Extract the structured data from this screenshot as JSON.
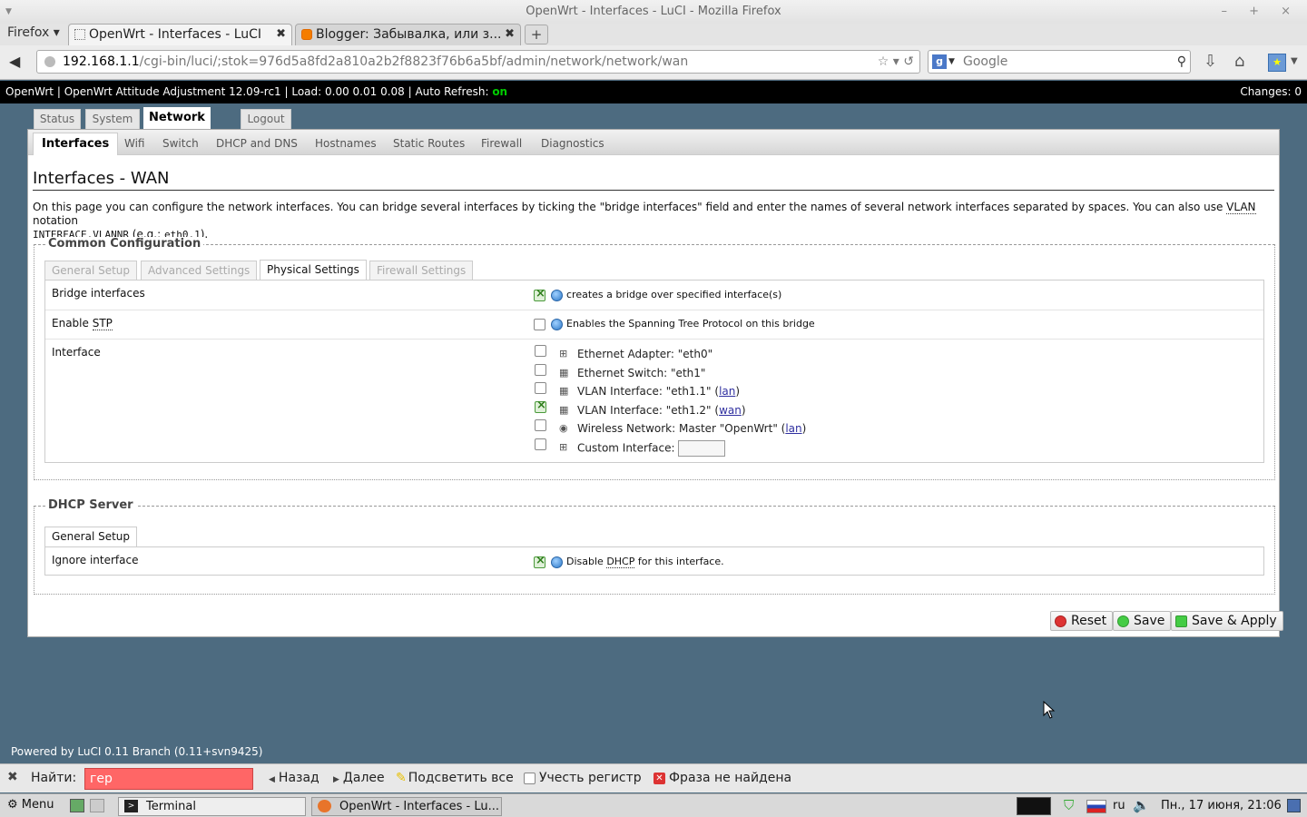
{
  "window": {
    "title": "OpenWrt - Interfaces - LuCI - Mozilla Firefox",
    "controls": "– + ×"
  },
  "firefox_menu": "Firefox ▾",
  "browser_tabs": [
    {
      "label": "OpenWrt - Interfaces - LuCI",
      "active": true
    },
    {
      "label": "Blogger: Забывалка, или з...",
      "active": false
    }
  ],
  "new_tab": "+",
  "urlbar": {
    "host": "192.168.1.1",
    "path": "/cgi-bin/luci/;stok=976d5a8fd2a810a2b2f8823f76b6a5bf/admin/network/network/wan",
    "tools": "☆ ▾ ↺"
  },
  "searchbar": {
    "engine": "g",
    "placeholder": "Google"
  },
  "luci_header": {
    "info": "OpenWrt | OpenWrt Attitude Adjustment 12.09-rc1 | Load: 0.00 0.01 0.08 | Auto Refresh: ",
    "auto_refresh": "on",
    "changes": "Changes: 0"
  },
  "main_tabs": [
    "Status",
    "System",
    "Network",
    "Logout"
  ],
  "sub_tabs": [
    "Interfaces",
    "Wifi",
    "Switch",
    "DHCP and DNS",
    "Hostnames",
    "Static Routes",
    "Firewall",
    "Diagnostics"
  ],
  "page": {
    "title": "Interfaces - WAN",
    "desc_1": "On this page you can configure the network interfaces. You can bridge several interfaces by ticking the \"bridge interfaces\" field and enter the names of several network interfaces separated by spaces. You can also use ",
    "desc_vlan": "VLAN",
    "desc_2": " notation",
    "desc_code1": "INTERFACE.VLANNR",
    "desc_3": " (",
    "desc_eg": "e.g.",
    "desc_4": ": ",
    "desc_code2": "eth0.1",
    "desc_5": ")."
  },
  "common": {
    "legend": "Common Configuration",
    "tabs": [
      "General Setup",
      "Advanced Settings",
      "Physical Settings",
      "Firewall Settings"
    ],
    "bridge": {
      "label": "Bridge interfaces",
      "checked": true,
      "help": "creates a bridge over specified interface(s)"
    },
    "stp": {
      "label_1": "Enable ",
      "label_abbr": "STP",
      "checked": false,
      "help": "Enables the Spanning Tree Protocol on this bridge"
    },
    "interface": {
      "label": "Interface",
      "options": [
        {
          "text": "Ethernet Adapter: \"eth0\"",
          "net": "",
          "checked": false,
          "icon": "ethernet-icon"
        },
        {
          "text": "Ethernet Switch: \"eth1\"",
          "net": "",
          "checked": false,
          "icon": "switch-icon"
        },
        {
          "text": "VLAN Interface: \"eth1.1\" (",
          "net": "lan",
          "checked": false,
          "icon": "switch-icon"
        },
        {
          "text": "VLAN Interface: \"eth1.2\" (",
          "net": "wan",
          "checked": true,
          "icon": "switch-icon"
        },
        {
          "text": "Wireless Network: Master \"OpenWrt\" (",
          "net": "lan",
          "checked": false,
          "icon": "wireless-icon"
        },
        {
          "text": "Custom Interface:",
          "net": "",
          "checked": false,
          "icon": "ethernet-icon"
        }
      ],
      "custom_value": ""
    }
  },
  "dhcp": {
    "legend": "DHCP Server",
    "tab": "General Setup",
    "ignore": {
      "label": "Ignore interface",
      "checked": true,
      "help_1": "Disable ",
      "help_abbr": "DHCP",
      "help_2": " for this interface."
    }
  },
  "buttons": {
    "reset": "Reset",
    "save": "Save",
    "apply": "Save & Apply"
  },
  "footer": "Powered by LuCI 0.11 Branch (0.11+svn9425)",
  "findbar": {
    "label": "Найти:",
    "value": "гер",
    "prev": "Назад",
    "next": "Далее",
    "highlight": "Подсветить все",
    "match_case": "Учесть регистр",
    "status": "Фраза не найдена"
  },
  "taskbar": {
    "menu": "Menu",
    "tasks": [
      "Terminal",
      "OpenWrt - Interfaces - Lu..."
    ],
    "lang": "ru",
    "clock": "Пн., 17 июня, 21:06"
  },
  "colors": {
    "luci_bg": "#4d6b80",
    "refresh_on": "#00cc00",
    "find_fail": "#ff6666"
  }
}
